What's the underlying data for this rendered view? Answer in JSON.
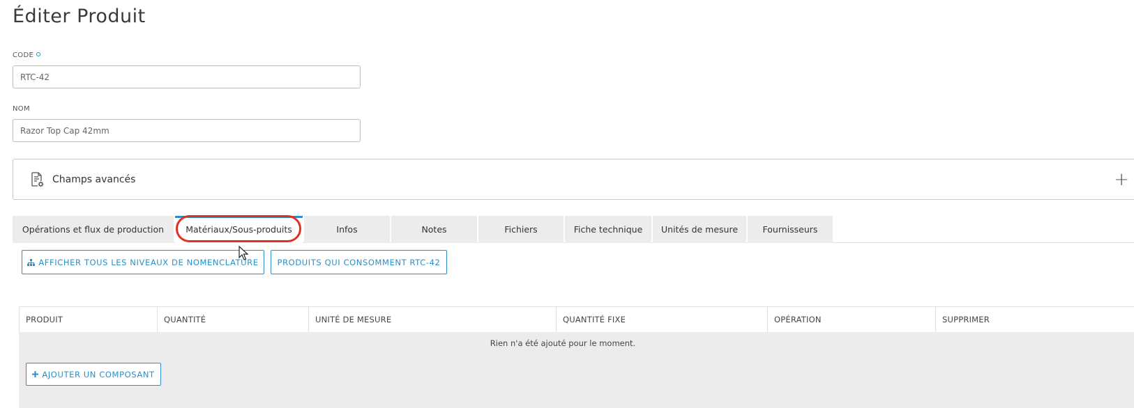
{
  "page": {
    "title": "Éditer Produit"
  },
  "form": {
    "code_label": "CODE",
    "code_value": "RTC-42",
    "name_label": "NOM",
    "name_value": "Razor Top Cap 42mm"
  },
  "advanced": {
    "label": "Champs avancés",
    "toggle": "+"
  },
  "tabs": [
    {
      "label": "Opérations et flux de production"
    },
    {
      "label": "Matériaux/Sous-produits",
      "active": true
    },
    {
      "label": "Infos"
    },
    {
      "label": "Notes"
    },
    {
      "label": "Fichiers"
    },
    {
      "label": "Fiche technique"
    },
    {
      "label": "Unités de mesure"
    },
    {
      "label": "Fournisseurs"
    }
  ],
  "actions": {
    "show_bom_levels": "AFFICHER TOUS LES NIVEAUX DE NOMENCLATURE",
    "consuming_products": "PRODUITS QUI CONSOMMENT RTC-42"
  },
  "table": {
    "columns": [
      "PRODUIT",
      "QUANTITÉ",
      "UNITÉ DE MESURE",
      "QUANTITÉ FIXE",
      "OPÉRATION",
      "SUPPRIMER"
    ],
    "empty_message": "Rien n'a été ajouté pour le moment.",
    "add_button": "AJOUTER UN COMPOSANT"
  },
  "colors": {
    "accent": "#2a8fc9",
    "highlight": "#e03022",
    "tab_bg": "#ececec"
  },
  "icons": [
    "sitemap-icon",
    "document-gear-icon",
    "plus-icon",
    "mouse-cursor-icon"
  ]
}
